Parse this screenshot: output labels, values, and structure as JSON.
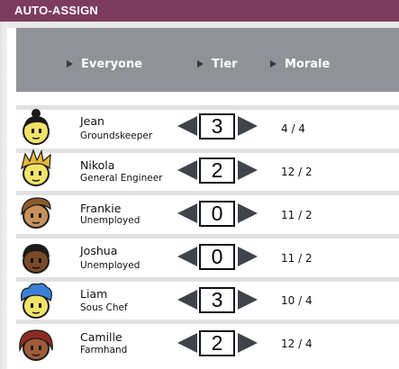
{
  "window": {
    "title": "AUTO-ASSIGN"
  },
  "header": {
    "columns": [
      {
        "label": "Everyone"
      },
      {
        "label": "Tier"
      },
      {
        "label": "Morale"
      }
    ]
  },
  "rows": [
    {
      "name": "Jean",
      "job": "Groundskeeper",
      "tier": "3",
      "morale": "4 / 4",
      "avatar": "jean-portrait-icon"
    },
    {
      "name": "Nikola",
      "job": "General Engineer",
      "tier": "2",
      "morale": "12 / 2",
      "avatar": "nikola-portrait-icon"
    },
    {
      "name": "Frankie",
      "job": "Unemployed",
      "tier": "0",
      "morale": "11 / 2",
      "avatar": "frankie-portrait-icon"
    },
    {
      "name": "Joshua",
      "job": "Unemployed",
      "tier": "0",
      "morale": "11 / 2",
      "avatar": "joshua-portrait-icon"
    },
    {
      "name": "Liam",
      "job": "Sous Chef",
      "tier": "3",
      "morale": "10 / 4",
      "avatar": "liam-portrait-icon"
    },
    {
      "name": "Camille",
      "job": "Farmhand",
      "tier": "2",
      "morale": "12 / 4",
      "avatar": "camille-portrait-icon"
    }
  ],
  "colors": {
    "titlebar": "#7d3b5e",
    "header": "#8f9296",
    "arrow": "#40434a",
    "skin": "#f2e36a",
    "dark_skin": "#7a4a28"
  }
}
